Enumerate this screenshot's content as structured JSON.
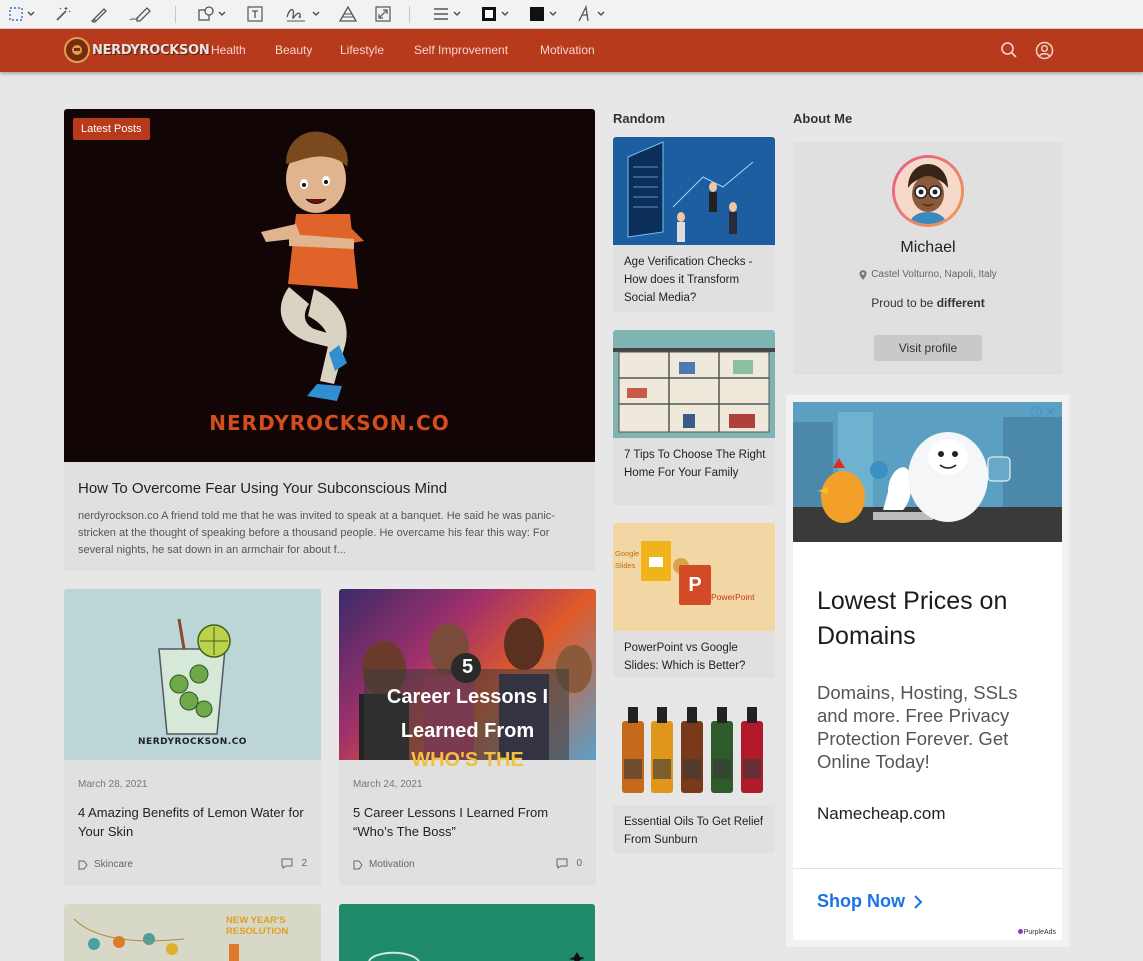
{
  "toolbar": {
    "tools": [
      "select-rectangle",
      "magic-wand",
      "sketch",
      "draw",
      "shapes",
      "text",
      "sign",
      "adjust-color",
      "adjust-size",
      "shape-style",
      "border-color",
      "fill-color",
      "text-style"
    ]
  },
  "nav": {
    "logo_text": "NERDYROCKSON",
    "links": [
      "Health",
      "Beauty",
      "Lifestyle",
      "Self Improvement",
      "Motivation"
    ],
    "accent": "#b83a1c"
  },
  "feature": {
    "badge": "Latest Posts",
    "watermark": "NERDYROCKSON.CO",
    "title": "How To Overcome Fear Using Your Subconscious Mind",
    "excerpt": "nerdyrockson.co A friend told me that he was invited to speak at a banquet. He said he was panic-stricken at the thought of speaking before a thousand people. He overcame his fear this way: For several nights, he sat down in an armchair for about f..."
  },
  "posts": [
    {
      "date": "March 28, 2021",
      "title": "4 Amazing Benefits of Lemon Water for Your Skin",
      "category": "Skincare",
      "comments": "2",
      "image_text": "NERDYROCKSON.CO"
    },
    {
      "date": "March 24, 2021",
      "title": "5 Career Lessons I Learned From “Who’s The Boss”",
      "category": "Motivation",
      "comments": "0",
      "image_number": "5",
      "image_line1": "Career Lessons I",
      "image_line2": "Learned From",
      "image_line3": "WHO'S THE"
    },
    {
      "image_line1": "NEW YEAR'S",
      "image_line2": "RESOLUTION"
    }
  ],
  "random": {
    "heading": "Random",
    "items": [
      {
        "title": "Age Verification Checks - How does it Transform Social Media?"
      },
      {
        "title": "7 Tips To Choose The Right Home For Your Family"
      },
      {
        "title": "PowerPoint vs Google Slides: Which is Better?",
        "image_label_1": "Google Slides",
        "image_label_2": "PowerPoint"
      },
      {
        "title": "Essential Oils To Get Relief From Sunburn"
      }
    ]
  },
  "about": {
    "heading": "About Me",
    "name": "Michael",
    "location": "Castel Volturno, Napoli, Italy",
    "tagline_prefix": "Proud to be",
    "tagline_bold": "different",
    "button": "Visit profile"
  },
  "ad": {
    "title": "Lowest Prices on Domains",
    "body": "Domains, Hosting, SSLs and more. Free Privacy Protection Forever. Get Online Today!",
    "domain": "Namecheap.com",
    "cta": "Shop Now",
    "brand": "PurpleAds"
  }
}
